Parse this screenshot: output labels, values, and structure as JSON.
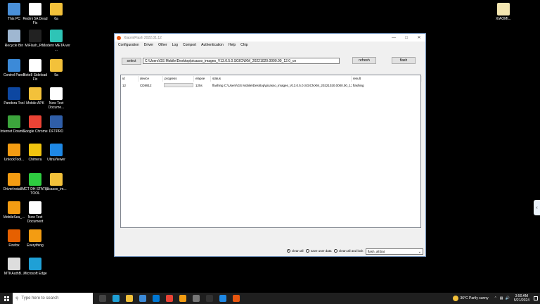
{
  "desktop": {
    "icons": [
      {
        "label": "This PC",
        "icon": "pc-icon",
        "color": "#4a90d9"
      },
      {
        "label": "Redmi 5A Dead Fix",
        "icon": "document-icon",
        "color": "#ffffff"
      },
      {
        "label": "6a",
        "icon": "folder-icon",
        "color": "#f3c13a"
      },
      {
        "label": "Recycle Bin",
        "icon": "recycle-bin-icon",
        "color": "#9fb7d1"
      },
      {
        "label": "MiFlash_Pr...",
        "icon": "mi-icon",
        "color": "#222222"
      },
      {
        "label": "Modern META ver ...",
        "icon": "meta-icon",
        "color": "#2ec4b6"
      },
      {
        "label": "Control Panel",
        "icon": "control-panel-icon",
        "color": "#3c8ad8"
      },
      {
        "label": "Note8 Sideload Fix",
        "icon": "document-icon",
        "color": "#ffffff"
      },
      {
        "label": "9a",
        "icon": "folder-icon",
        "color": "#f3c13a"
      },
      {
        "label": "Pandora Tool",
        "icon": "pandora-icon",
        "color": "#0d47a1"
      },
      {
        "label": "Mobile APK",
        "icon": "folder-icon",
        "color": "#f3c13a"
      },
      {
        "label": "New Text Docume...",
        "icon": "text-document-icon",
        "color": "#ffffff"
      },
      {
        "label": "Internet Downlo...",
        "icon": "idm-icon",
        "color": "#3ca43c"
      },
      {
        "label": "Google Chrome",
        "icon": "chrome-icon",
        "color": "#ea4335"
      },
      {
        "label": "DFTPRO",
        "icon": "dftpro-icon",
        "color": "#2f5ea8"
      },
      {
        "label": "UnlockTool...",
        "icon": "unlocktool-icon",
        "color": "#f39c12"
      },
      {
        "label": "Chimera",
        "icon": "chimera-icon",
        "color": "#f1c40f"
      },
      {
        "label": "UltraViewer",
        "icon": "ultraviewer-icon",
        "color": "#1e88e5"
      },
      {
        "label": "DriverInstall...",
        "icon": "driver-icon",
        "color": "#f39c12"
      },
      {
        "label": "MCT DH STATIC TOOL",
        "icon": "mct-icon",
        "color": "#2ecc40"
      },
      {
        "label": "picasso_im...",
        "icon": "archive-icon",
        "color": "#f3c13a"
      },
      {
        "label": "MobileSea_...",
        "icon": "mobilesea-icon",
        "color": "#f39c12"
      },
      {
        "label": "New Text Document",
        "icon": "text-document-icon",
        "color": "#ffffff"
      },
      {
        "label": "Firefox",
        "icon": "firefox-icon",
        "color": "#e66000"
      },
      {
        "label": "Everything",
        "icon": "everything-icon",
        "color": "#f39c12"
      },
      {
        "label": "MTKAuthB...",
        "icon": "mtk-icon",
        "color": "#dddddd"
      },
      {
        "label": "Microsoft Edge",
        "icon": "edge-icon",
        "color": "#1fa0d6"
      },
      {
        "label": "XIAOMI...",
        "icon": "document-icon",
        "color": "#f3e5b0"
      }
    ]
  },
  "window": {
    "title": "XiaomiFlash 2022.01.12",
    "menu": [
      "Configuration",
      "Driver",
      "Other",
      "Log",
      "Comport",
      "Authentication",
      "Help",
      "Chip"
    ],
    "select_label": "select",
    "path": "C:\\Users\\GS Mobile\\Desktop\\picasso_images_V13.0.5.0.SGICNXM_20221020.0000.00_12.0_cn",
    "refresh_label": "refresh",
    "flash_label": "flash",
    "columns": [
      "id",
      "device",
      "progress",
      "elapse",
      "status",
      "result"
    ],
    "rows": [
      {
        "id": "12",
        "device": "CD8912",
        "progress": 0,
        "elapse": "125s",
        "status": "flashing C:\\Users\\GS Mobile\\Desktop\\picasso_images_V13.0.5.0.SGICNXM_20221020.0000.00_12...",
        "result": "flashing"
      }
    ],
    "options": {
      "clean_all": "clean all",
      "save_user_data": "save user data",
      "clean_all_lock": "clean all and lock",
      "selected": "clean_all",
      "script": "flash_all.bat"
    }
  },
  "taskbar": {
    "search_placeholder": "Type here to search",
    "weather": "36°C  Partly sunny",
    "time": "3:50 AM",
    "date": "5/21/2024"
  }
}
